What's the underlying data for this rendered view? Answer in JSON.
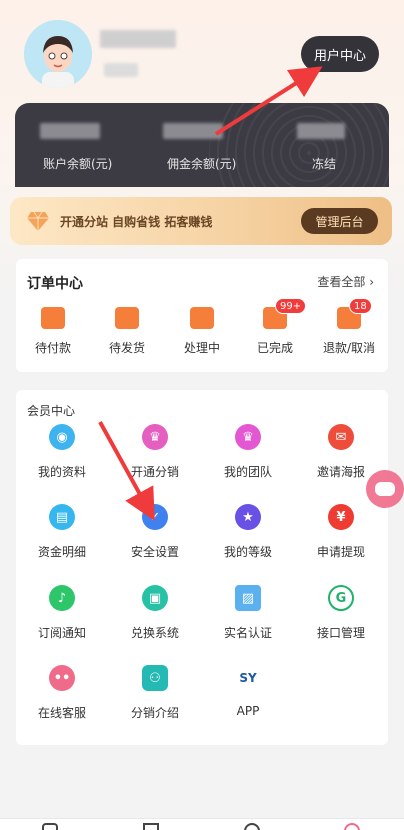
{
  "header": {
    "user_center_label": "用户中心"
  },
  "balance": {
    "items": [
      {
        "label": "账户余额(元)"
      },
      {
        "label": "佣金余额(元)"
      },
      {
        "label": "冻结"
      }
    ]
  },
  "promo": {
    "text": "开通分站 自购省钱 拓客赚钱",
    "admin_label": "管理后台"
  },
  "orders": {
    "title": "订单中心",
    "view_all": "查看全部",
    "items": [
      {
        "label": "待付款",
        "badge": ""
      },
      {
        "label": "待发货",
        "badge": ""
      },
      {
        "label": "处理中",
        "badge": ""
      },
      {
        "label": "已完成",
        "badge": "99+"
      },
      {
        "label": "退款/取消",
        "badge": "18"
      }
    ]
  },
  "member": {
    "title": "会员中心",
    "items": [
      {
        "label": "我的资料",
        "color": "#3fb3f0"
      },
      {
        "label": "开通分销",
        "color": "#e45fbf"
      },
      {
        "label": "我的团队",
        "color": "#e457d2"
      },
      {
        "label": "邀请海报",
        "color": "#ee4d3c"
      },
      {
        "label": "资金明细",
        "color": "#36b6ee"
      },
      {
        "label": "安全设置",
        "color": "#3f82ef"
      },
      {
        "label": "我的等级",
        "color": "#6a51e6"
      },
      {
        "label": "申请提现",
        "color": "#ef3b32"
      },
      {
        "label": "订阅通知",
        "color": "#2ec66a"
      },
      {
        "label": "兑换系统",
        "color": "#27c2a5"
      },
      {
        "label": "实名认证",
        "color": "#5bb1ef"
      },
      {
        "label": "接口管理",
        "color": "#1fb36a"
      },
      {
        "label": "在线客服",
        "color": "#f06b8a"
      },
      {
        "label": "分销介绍",
        "color": "#24b9b3"
      },
      {
        "label": "APP",
        "color": "#1e5aa0"
      }
    ]
  }
}
